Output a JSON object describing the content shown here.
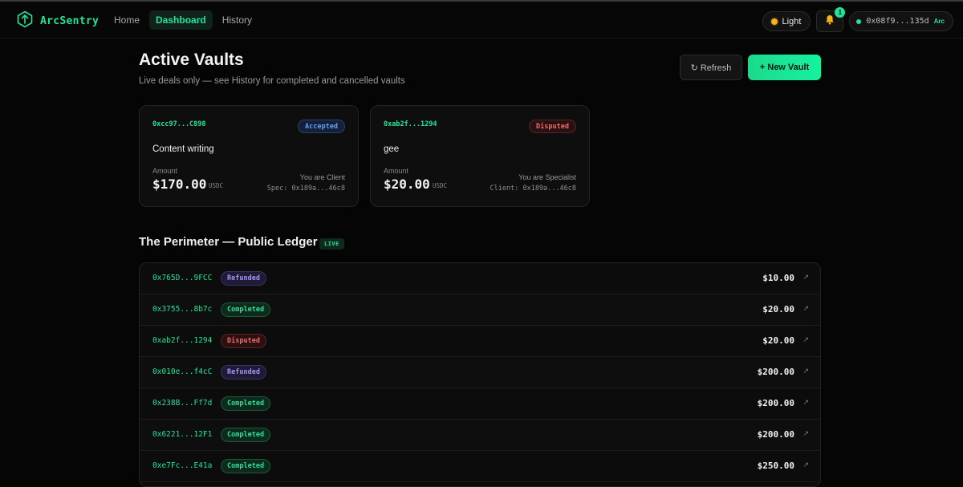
{
  "nav": {
    "brand": "ArcSentry",
    "links": [
      "Home",
      "Dashboard",
      "History"
    ],
    "active": 1,
    "theme_label": "Light",
    "notification_count": "1",
    "wallet": "0x08f9...135d",
    "chain": "Arc"
  },
  "header": {
    "title": "Active Vaults",
    "subtitle": "Live deals only — see History for completed and cancelled vaults",
    "refresh_label": "↻ Refresh",
    "new_vault_label": "+ New Vault"
  },
  "vaults": [
    {
      "id": "0xcc97...C898",
      "status": "Accepted",
      "title": "Content writing",
      "amount_label": "Amount",
      "amount": "$170.00",
      "currency": "USDC",
      "role": "You are Client",
      "party": "Spec: 0x189a...46c8"
    },
    {
      "id": "0xab2f...1294",
      "status": "Disputed",
      "title": "gee",
      "amount_label": "Amount",
      "amount": "$20.00",
      "currency": "USDC",
      "role": "You are Specialist",
      "party": "Client: 0x189a...46c8"
    }
  ],
  "ledger": {
    "title": "The Perimeter — Public Ledger",
    "live_label": "LIVE",
    "link_glyph": "↗",
    "rows": [
      {
        "id": "0x765D...9FCC",
        "status": "Refunded",
        "amount": "$10.00"
      },
      {
        "id": "0x3755...8b7c",
        "status": "Completed",
        "amount": "$20.00"
      },
      {
        "id": "0xab2f...1294",
        "status": "Disputed",
        "amount": "$20.00"
      },
      {
        "id": "0x010e...f4cC",
        "status": "Refunded",
        "amount": "$200.00"
      },
      {
        "id": "0x238B...Ff7d",
        "status": "Completed",
        "amount": "$200.00"
      },
      {
        "id": "0x6221...12F1",
        "status": "Completed",
        "amount": "$200.00"
      },
      {
        "id": "0xe7Fc...E41a",
        "status": "Completed",
        "amount": "$250.00"
      }
    ]
  },
  "colors": {
    "accent": "#22e39a",
    "background": "#050505",
    "accepted": "#6a9ef5",
    "disputed": "#ef6a6a",
    "refunded": "#a592ee"
  }
}
